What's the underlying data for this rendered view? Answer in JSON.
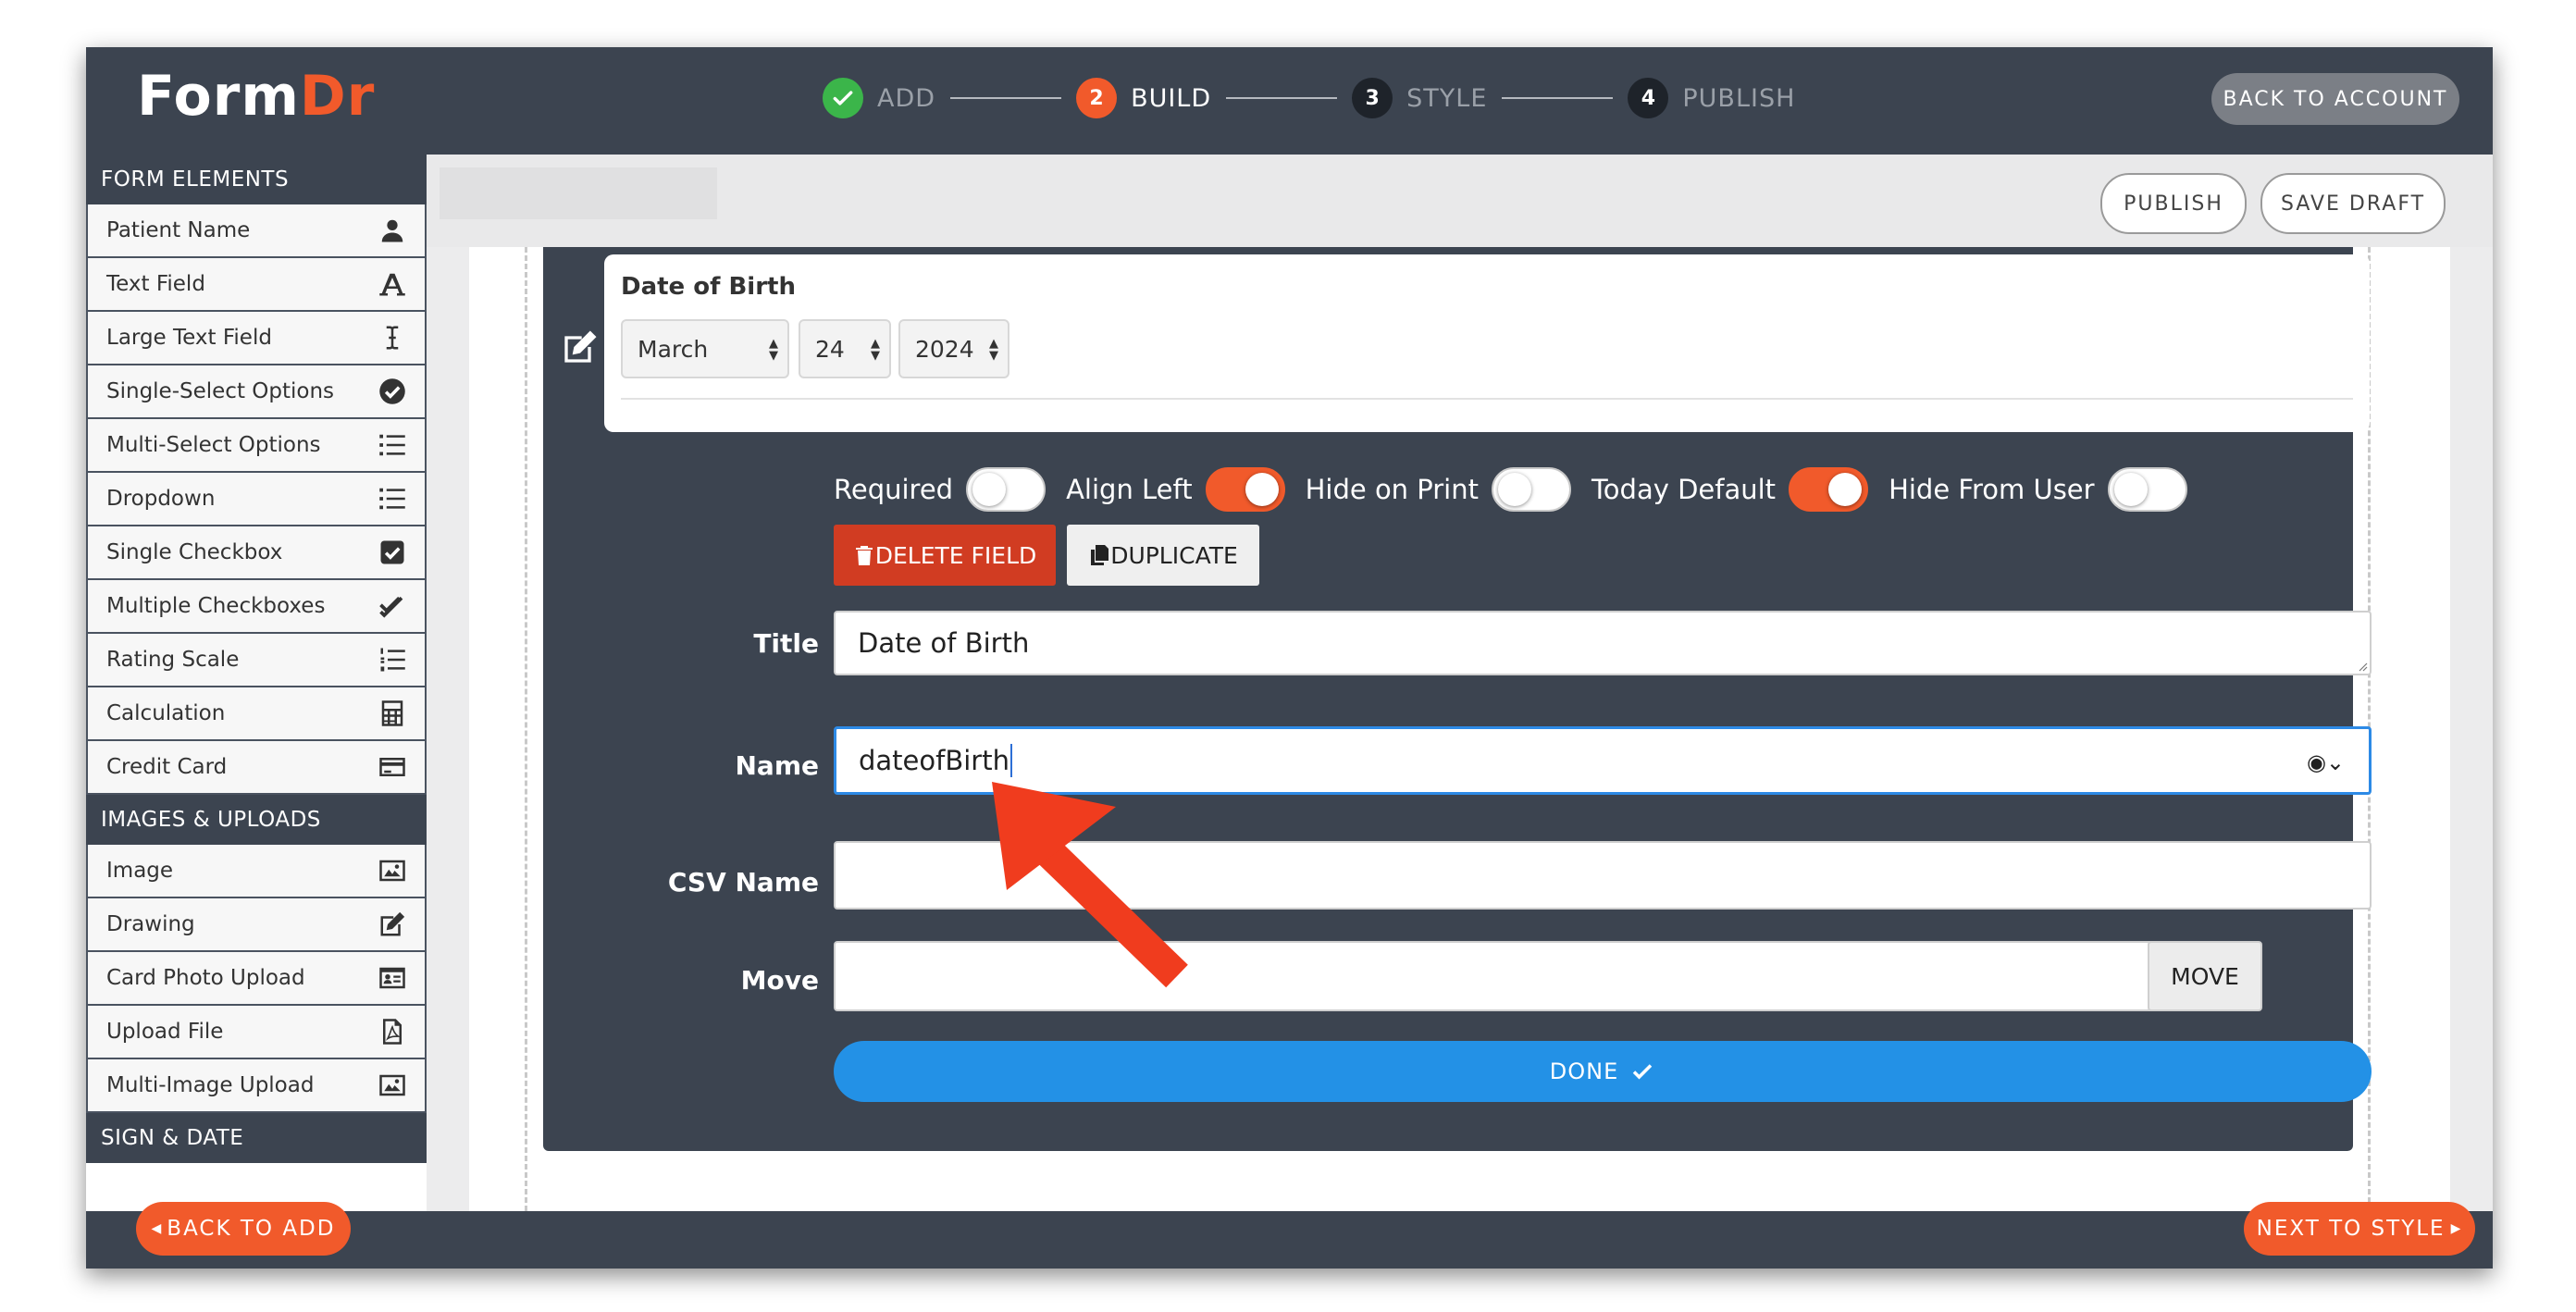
{
  "app": {
    "logo_part1": "Form",
    "logo_part2": "Dr",
    "brand_color": "#f15a2b",
    "back_to_account": "BACK TO ACCOUNT"
  },
  "steps": [
    {
      "number": "",
      "label": "ADD",
      "state": "done"
    },
    {
      "number": "2",
      "label": "BUILD",
      "state": "active"
    },
    {
      "number": "3",
      "label": "STYLE",
      "state": "idle"
    },
    {
      "number": "4",
      "label": "PUBLISH",
      "state": "idle"
    }
  ],
  "toolbar": {
    "publish": "PUBLISH",
    "save_draft": "SAVE DRAFT"
  },
  "sidebar": {
    "section_form_elements": "FORM ELEMENTS",
    "form_elements": [
      {
        "label": "Patient Name",
        "icon": "user-icon"
      },
      {
        "label": "Text Field",
        "icon": "letter-a-icon"
      },
      {
        "label": "Large Text Field",
        "icon": "text-cursor-icon"
      },
      {
        "label": "Single-Select Options",
        "icon": "check-circle-icon"
      },
      {
        "label": "Multi-Select Options",
        "icon": "list-icon"
      },
      {
        "label": "Dropdown",
        "icon": "list-icon"
      },
      {
        "label": "Single Checkbox",
        "icon": "checkbox-icon"
      },
      {
        "label": "Multiple Checkboxes",
        "icon": "double-check-icon"
      },
      {
        "label": "Rating Scale",
        "icon": "numbered-list-icon"
      },
      {
        "label": "Calculation",
        "icon": "calculator-icon"
      },
      {
        "label": "Credit Card",
        "icon": "credit-card-icon"
      }
    ],
    "section_images": "IMAGES & UPLOADS",
    "images_uploads": [
      {
        "label": "Image",
        "icon": "image-icon"
      },
      {
        "label": "Drawing",
        "icon": "pencil-square-icon"
      },
      {
        "label": "Card Photo Upload",
        "icon": "id-card-icon"
      },
      {
        "label": "Upload File",
        "icon": "pdf-file-icon"
      },
      {
        "label": "Multi-Image Upload",
        "icon": "image-icon"
      }
    ],
    "section_sign_date": "SIGN & DATE"
  },
  "preview": {
    "title": "Date of Birth",
    "month": "March",
    "day": "24",
    "year": "2024"
  },
  "toggles": [
    {
      "label": "Required",
      "on": false
    },
    {
      "label": "Align Left",
      "on": true
    },
    {
      "label": "Hide on Print",
      "on": false
    },
    {
      "label": "Today Default",
      "on": true
    },
    {
      "label": "Hide From User",
      "on": false
    }
  ],
  "actions": {
    "delete": "DELETE FIELD",
    "duplicate": "DUPLICATE"
  },
  "form": {
    "title_label": "Title",
    "title_value": "Date of Birth",
    "name_label": "Name",
    "name_value": "dateofBirth",
    "csv_label": "CSV Name",
    "csv_value": "",
    "move_label": "Move",
    "move_value": "",
    "move_button": "MOVE",
    "done_button": "DONE"
  },
  "footer": {
    "back_to_add": "BACK TO ADD",
    "next_to_style": "NEXT TO STYLE"
  }
}
